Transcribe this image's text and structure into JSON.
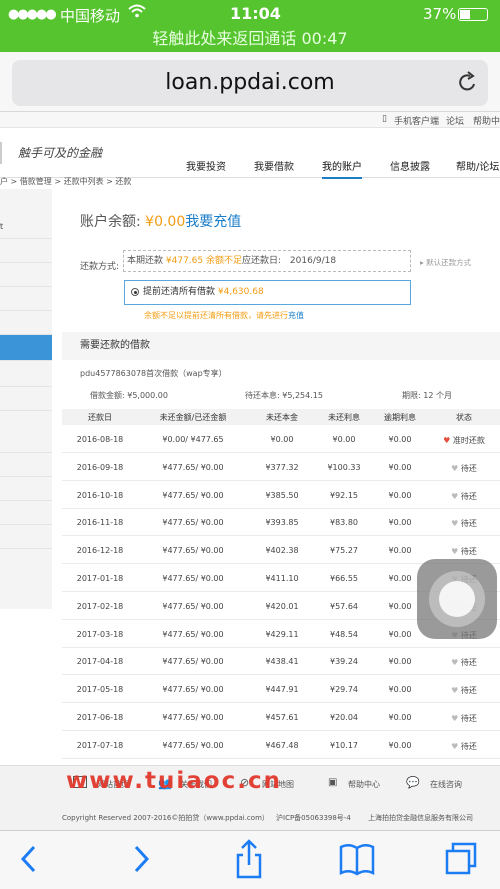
{
  "status": {
    "dots": "●●●●●",
    "carrier": "中国移动",
    "time": "11:04",
    "battery": "37%"
  },
  "callbar": "轻触此处来返回通话 00:47",
  "browser": {
    "url": "loan.ppdai.com",
    "reload_icon": "reload-icon"
  },
  "topbar": {
    "client": "手机客户端",
    "forum": "论坛",
    "help": "帮助中"
  },
  "logo_text": "触手可及的金融",
  "nav": [
    "我要投资",
    "我要借款",
    "我的账户",
    "信息披露",
    "帮助/论坛"
  ],
  "breadcrumb": "户 > 借款管理 > 还款中列表 > 还款",
  "sidebar_text": "t",
  "balance": {
    "label": "账户余额:",
    "value": "¥0.00",
    "link": "我要充值"
  },
  "repay": {
    "method_label": "还款方式:",
    "period_label": "本期还款",
    "period_amount": "¥477.65",
    "insufficient": "余额不足",
    "due_label": "应还款日:",
    "due_date": "2016/9/18",
    "default_link": "默认还款方式",
    "prepay_label": "提前还清所有借款",
    "prepay_amount": "¥4,630.68",
    "warn": "余额不足以提前还清所有借款，请先进行",
    "warn_link": "充值"
  },
  "section_title": "需要还款的借款",
  "loan": {
    "name": "pdu4577863078首次借款（wap专享）",
    "amount": "借款金额: ¥5,000.00",
    "principal": "待还本息: ¥5,254.15",
    "term": "期限: 12 个月"
  },
  "table": {
    "headers": [
      "还款日",
      "未还金额/已还金额",
      "未还本金",
      "未还利息",
      "逾期利息",
      "状态"
    ],
    "rows": [
      [
        "2016-08-18",
        "¥0.00/ ¥477.65",
        "¥0.00",
        "¥0.00",
        "¥0.00",
        "准时还款"
      ],
      [
        "2016-09-18",
        "¥477.65/ ¥0.00",
        "¥377.32",
        "¥100.33",
        "¥0.00",
        "待还"
      ],
      [
        "2016-10-18",
        "¥477.65/ ¥0.00",
        "¥385.50",
        "¥92.15",
        "¥0.00",
        "待还"
      ],
      [
        "2016-11-18",
        "¥477.65/ ¥0.00",
        "¥393.85",
        "¥83.80",
        "¥0.00",
        "待还"
      ],
      [
        "2016-12-18",
        "¥477.65/ ¥0.00",
        "¥402.38",
        "¥75.27",
        "¥0.00",
        "待还"
      ],
      [
        "2017-01-18",
        "¥477.65/ ¥0.00",
        "¥411.10",
        "¥66.55",
        "¥0.00",
        "待还"
      ],
      [
        "2017-02-18",
        "¥477.65/ ¥0.00",
        "¥420.01",
        "¥57.64",
        "¥0.00",
        "待还"
      ],
      [
        "2017-03-18",
        "¥477.65/ ¥0.00",
        "¥429.11",
        "¥48.54",
        "¥0.00",
        "待还"
      ],
      [
        "2017-04-18",
        "¥477.65/ ¥0.00",
        "¥438.41",
        "¥39.24",
        "¥0.00",
        "待还"
      ],
      [
        "2017-05-18",
        "¥477.65/ ¥0.00",
        "¥447.91",
        "¥29.74",
        "¥0.00",
        "待还"
      ],
      [
        "2017-06-18",
        "¥477.65/ ¥0.00",
        "¥457.61",
        "¥20.04",
        "¥0.00",
        "待还"
      ],
      [
        "2017-07-18",
        "¥477.65/ ¥0.00",
        "¥467.48",
        "¥10.17",
        "¥0.00",
        "待还"
      ]
    ]
  },
  "footer": {
    "links": [
      "网站首页",
      "关于我们",
      "网站地图",
      "帮助中心",
      "在线咨询"
    ],
    "copyright": "Copyright Reserved 2007-2016©拍拍贷（www.ppdai.com）",
    "icp": "沪ICP备05063398号-4",
    "company": "上海拍拍贷金融信息服务有限公司"
  },
  "watermark": "www.tuiaoc.cn",
  "toolbar_icons": [
    "back-icon",
    "forward-icon",
    "share-icon",
    "bookmarks-icon",
    "tabs-icon"
  ],
  "colors": {
    "green": "#56c42e",
    "accent": "#1a7dc9",
    "orange": "#f39c12",
    "heart": "#e84c3d"
  }
}
